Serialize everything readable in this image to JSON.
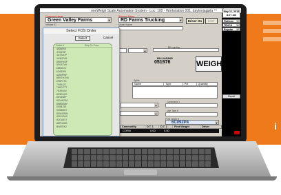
{
  "window": {
    "title": "oneWeigh Scale Automation System - Loc: 100 - Workstation 001, daytonjagiela",
    "controls": "_ □ X"
  },
  "customer": {
    "label": "Customer Name",
    "value": "Green Valley Farms",
    "sub_label": "Vehicle ID"
  },
  "shipper": {
    "label": "Shipped Name",
    "value": "RD Farms Trucking",
    "sub_label": "Model Name"
  },
  "buttons": {
    "driver_on": "Driver On",
    "exit": "EXIT",
    "weigh": "WEIGH",
    "recall": "Recall"
  },
  "bill_of_lading": {
    "label": "BILL/ADING",
    "value": "051976",
    "sub_label": "Bill number"
  },
  "splits": {
    "label": "Splits",
    "columns": [
      "Name",
      "Type",
      "Pct",
      "Quantity"
    ]
  },
  "commands": {
    "label_1": "Command 1",
    "label_2": "Use Tare #"
  },
  "fos_order": {
    "label": "FOS Order #",
    "value": "6C092P4"
  },
  "grid": {
    "columns": [
      "Commodity",
      "D.T. 1",
      "D.T. 2",
      "First Weight",
      "Driver"
    ],
    "row": [
      "CORN",
      "0.00",
      "0.00"
    ]
  },
  "datetime": {
    "date": "May 11, 2018",
    "time": "8:27 am"
  },
  "right_panel": {
    "platform": "Platform",
    "truck": "TRUCK",
    "regular": "Regular"
  },
  "dialog": {
    "title": "Select FOS Order",
    "select_label": "Select",
    "cancel_label": "Cancel",
    "columns": [
      "Order #",
      "Ship To Posn"
    ],
    "orders": [
      "4508E5S",
      "4740F3P",
      "4G7SH7P",
      "4U6EPVR",
      "5W9FNSP",
      "5FG4TVH",
      "68K51VV",
      "6C082P4",
      "6Z55PWP",
      "6RKTm7NV",
      "6F8PV7S",
      "7V5SJ2Z",
      "7W6YT7T",
      "7E3KN4V",
      "8C5EH2G",
      "8KV6S8P",
      "8GVW2EG",
      "8WB5SMF",
      "8V5BJ3S",
      "9G53MD7",
      "8GWLR6N",
      "ASHV2LW",
      "AZGA4V7",
      "A5PN4CB",
      "BN57EK2"
    ]
  },
  "colors": {
    "brand_orange": "#ee7a1c",
    "list_green": "#cfe9b6",
    "label_red": "#d01010"
  }
}
